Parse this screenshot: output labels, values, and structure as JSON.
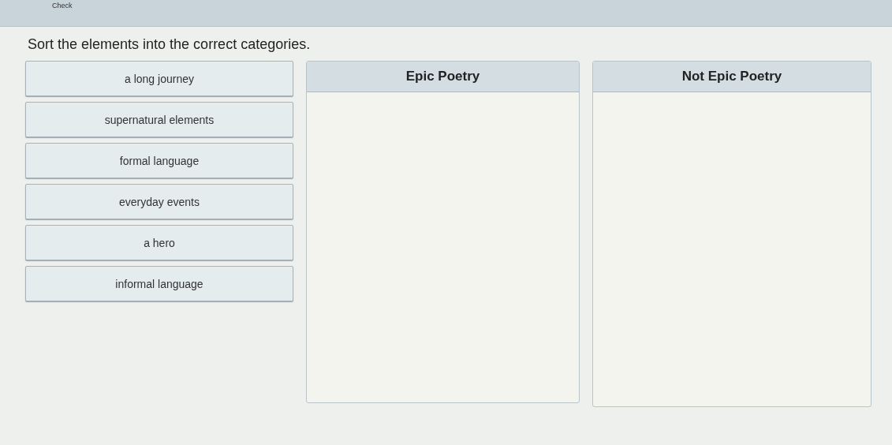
{
  "toolbar": {
    "button": "Check"
  },
  "instruction": "Sort the elements into the correct categories.",
  "items": [
    {
      "label": "a long journey"
    },
    {
      "label": "supernatural elements"
    },
    {
      "label": "formal language"
    },
    {
      "label": "everyday events"
    },
    {
      "label": "a hero"
    },
    {
      "label": "informal language"
    }
  ],
  "categories": [
    {
      "title": "Epic Poetry"
    },
    {
      "title": "Not Epic Poetry"
    }
  ]
}
